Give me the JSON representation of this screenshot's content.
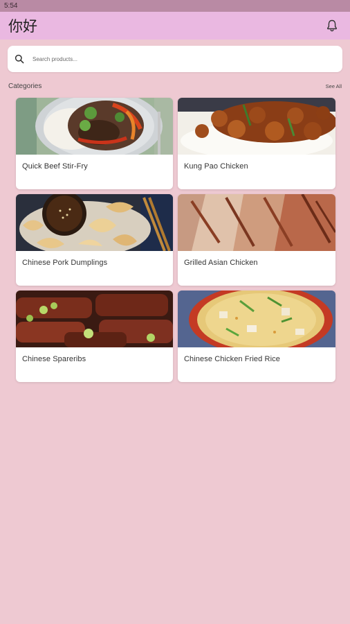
{
  "status_bar": {
    "time": "5:54"
  },
  "app_bar": {
    "title": "你好",
    "notification_icon": "bell-icon"
  },
  "search": {
    "placeholder": "Search products...",
    "icon": "search-icon"
  },
  "categories": {
    "title": "Categories",
    "see_all_label": "See All",
    "items": [
      {
        "label": "Quick Beef Stir-Fry"
      },
      {
        "label": "Kung Pao Chicken"
      },
      {
        "label": "Chinese Pork Dumplings"
      },
      {
        "label": "Grilled Asian Chicken"
      },
      {
        "label": "Chinese Spareribs"
      },
      {
        "label": "Chinese Chicken Fried Rice"
      }
    ]
  },
  "colors": {
    "background": "#eec9d2",
    "app_bar": "#eab8e1",
    "status_bar": "#b98aa4",
    "card": "#ffffff"
  }
}
